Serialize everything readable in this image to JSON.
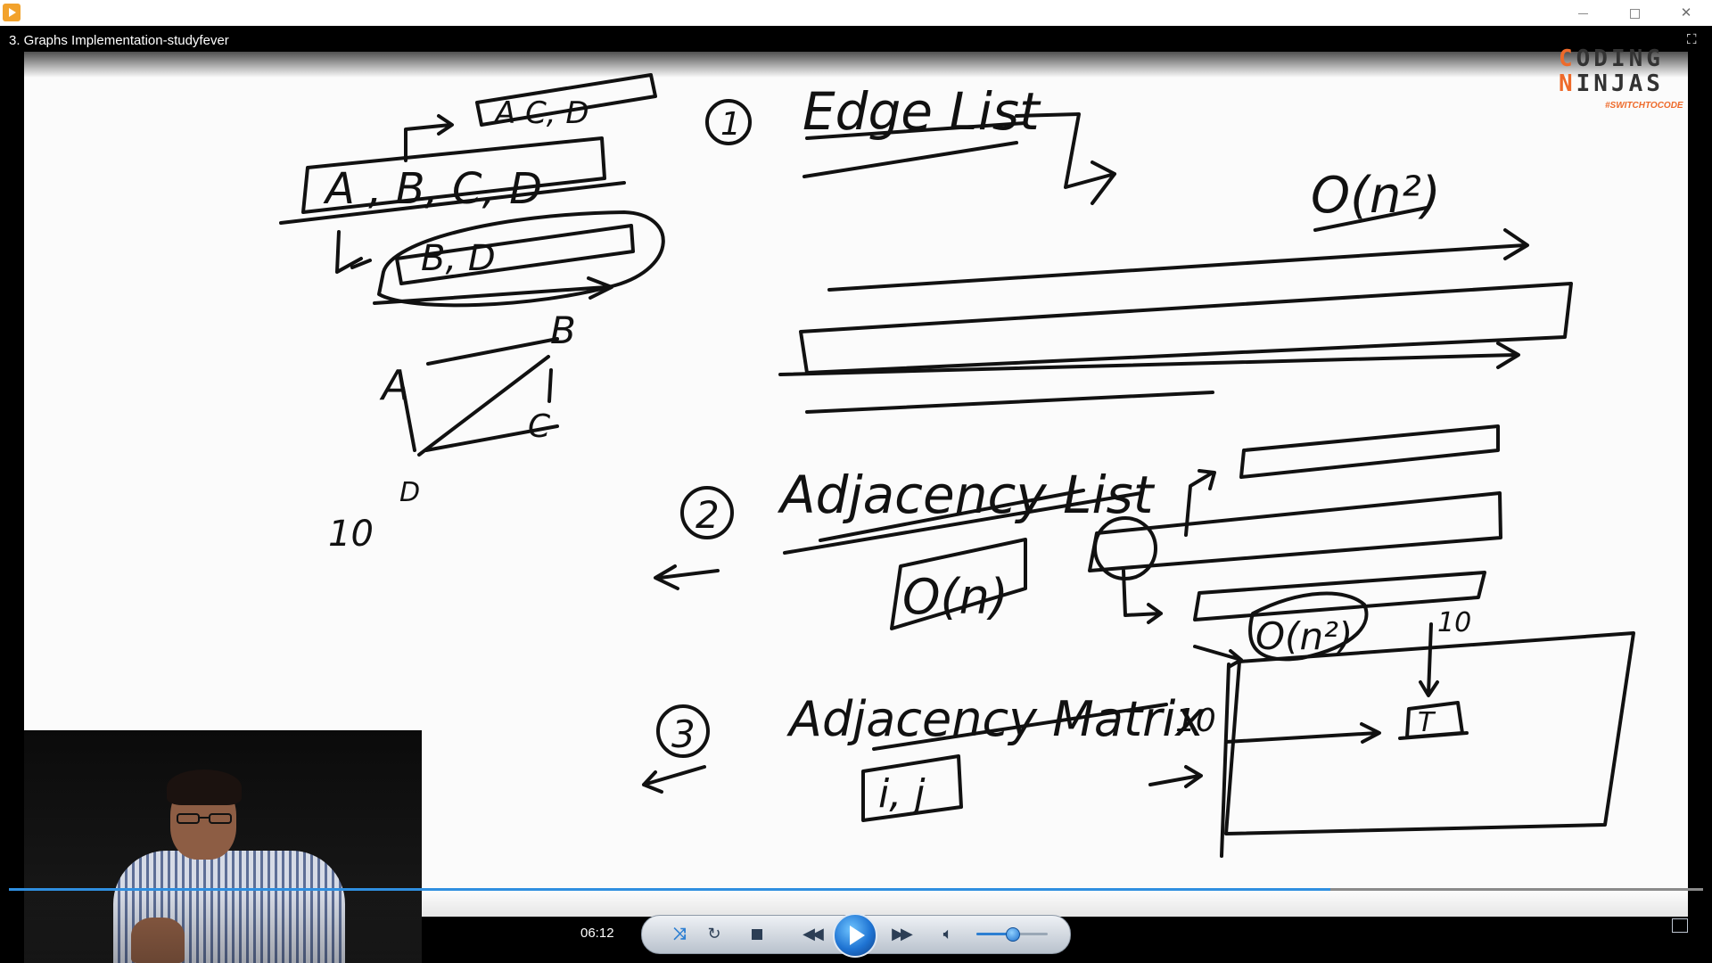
{
  "window": {
    "title": "3. Graphs Implementation-studyfever",
    "buttons": {
      "minimize": "minimize",
      "maximize": "maximize",
      "close": "close"
    }
  },
  "logo": {
    "line1_first": "C",
    "line1_rest": "ODING",
    "line2_first": "N",
    "line2_rest": "INJAS",
    "tagline": "#SWITCHTOCODE"
  },
  "board": {
    "top_box_text": "A C, D",
    "list_text": "A , B, C, D",
    "sub_list_text": "B, D",
    "node_a": "A",
    "node_b": "B",
    "node_c": "C",
    "node_d": "D",
    "count_left": "10",
    "item1_num": "1",
    "item1_title": "Edge List",
    "item1_complexity": "O(n²)",
    "item2_num": "2",
    "item2_title": "Adjacency List",
    "item2_complexity": "O(n)",
    "item2_cell": "O(n²)",
    "item3_num": "3",
    "item3_title": "Adjacency Matrix",
    "item3_index": "i, j",
    "matrix_row_label": "10",
    "matrix_col_label": "10",
    "matrix_cell": "T"
  },
  "player": {
    "time": "06:12",
    "progress": 0.78,
    "volume": 0.45,
    "icons": {
      "shuffle": "shuffle-icon",
      "repeat": "repeat-icon",
      "stop": "stop-icon",
      "previous": "previous-icon",
      "play": "play-icon",
      "next": "next-icon",
      "volume": "volume-icon"
    }
  },
  "colors": {
    "ink": "#111111",
    "progress": "#2f8fe0",
    "logo_accent": "#ee6a2a"
  }
}
